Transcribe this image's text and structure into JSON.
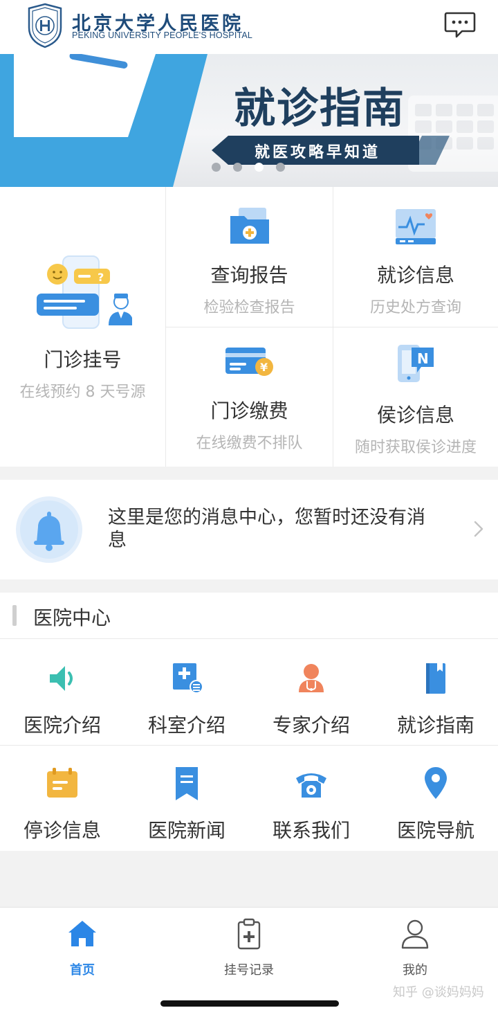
{
  "header": {
    "hospital_name_cn": "北京大学人民医院",
    "hospital_name_en": "PEKING UNIVERSITY PEOPLE'S HOSPITAL",
    "message_icon": "chat-bubble-icon"
  },
  "banner": {
    "title": "就诊指南",
    "subtitle": "就医攻略早知道",
    "slide_count": 4,
    "active_slide": 3
  },
  "services": {
    "registration": {
      "title": "门诊挂号",
      "subtitle": "在线预约 8 天号源",
      "icon": "chat-doctor-icon"
    },
    "report": {
      "title": "查询报告",
      "subtitle": "检验检查报告",
      "icon": "medical-folder-icon"
    },
    "visit_info": {
      "title": "就诊信息",
      "subtitle": "历史处方查询",
      "icon": "health-monitor-icon"
    },
    "payment": {
      "title": "门诊缴费",
      "subtitle": "在线缴费不排队",
      "icon": "payment-card-icon"
    },
    "queue": {
      "title": "侯诊信息",
      "subtitle": "随时获取侯诊进度",
      "icon": "notification-phone-icon"
    }
  },
  "message_center": {
    "text": "这里是您的消息中心，您暂时还没有消息"
  },
  "hospital_center": {
    "title": "医院中心",
    "items": [
      {
        "label": "医院介绍",
        "icon": "speaker-icon",
        "color": "#3bbfb1"
      },
      {
        "label": "科室介绍",
        "icon": "department-icon",
        "color": "#3a8fe0"
      },
      {
        "label": "专家介绍",
        "icon": "doctor-icon",
        "color": "#f0845c"
      },
      {
        "label": "就诊指南",
        "icon": "guide-book-icon",
        "color": "#3a8fe0"
      },
      {
        "label": "停诊信息",
        "icon": "calendar-icon",
        "color": "#f2b640"
      },
      {
        "label": "医院新闻",
        "icon": "bookmark-news-icon",
        "color": "#3a8fe0"
      },
      {
        "label": "联系我们",
        "icon": "telephone-icon",
        "color": "#3a8fe0"
      },
      {
        "label": "医院导航",
        "icon": "location-pin-icon",
        "color": "#3a8fe0"
      }
    ]
  },
  "tabbar": {
    "items": [
      {
        "label": "首页",
        "icon": "home-icon",
        "active": true
      },
      {
        "label": "挂号记录",
        "icon": "clipboard-icon",
        "active": false
      },
      {
        "label": "我的",
        "icon": "user-icon",
        "active": false
      }
    ]
  },
  "watermark": "知乎 @谈妈妈妈",
  "colors": {
    "accent_blue": "#2b86e6",
    "brand_navy": "#1e4b7a",
    "subtitle_gray": "#b5b5b5"
  }
}
